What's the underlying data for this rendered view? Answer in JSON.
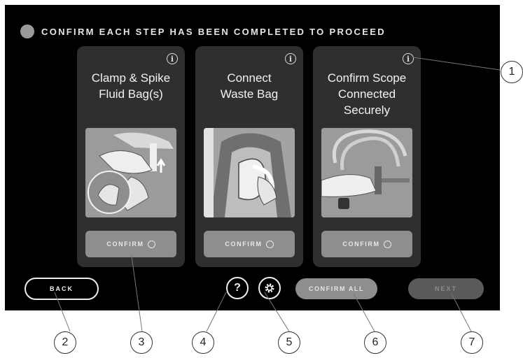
{
  "header": {
    "title": "CONFIRM EACH STEP HAS BEEN COMPLETED TO PROCEED"
  },
  "cards": [
    {
      "title_lines": [
        "Clamp & Spike",
        "Fluid Bag(s)"
      ],
      "info_icon": "i",
      "confirm_label": "CONFIRM"
    },
    {
      "title_lines": [
        "Connect",
        "Waste Bag"
      ],
      "info_icon": "i",
      "confirm_label": "CONFIRM"
    },
    {
      "title_lines": [
        "Confirm Scope",
        "Connected",
        "Securely"
      ],
      "info_icon": "i",
      "confirm_label": "CONFIRM"
    }
  ],
  "footer": {
    "back_label": "BACK",
    "help_icon": "?",
    "settings_icon": "gear-icon",
    "confirm_all_label": "CONFIRM ALL",
    "next_label": "NEXT"
  },
  "callouts": [
    "1",
    "2",
    "3",
    "4",
    "5",
    "6",
    "7"
  ],
  "colors": {
    "screen_bg": "#000000",
    "card_bg": "#2f2f2f",
    "button_gray": "#8e8e8e",
    "next_disabled": "#5a5a5a"
  }
}
